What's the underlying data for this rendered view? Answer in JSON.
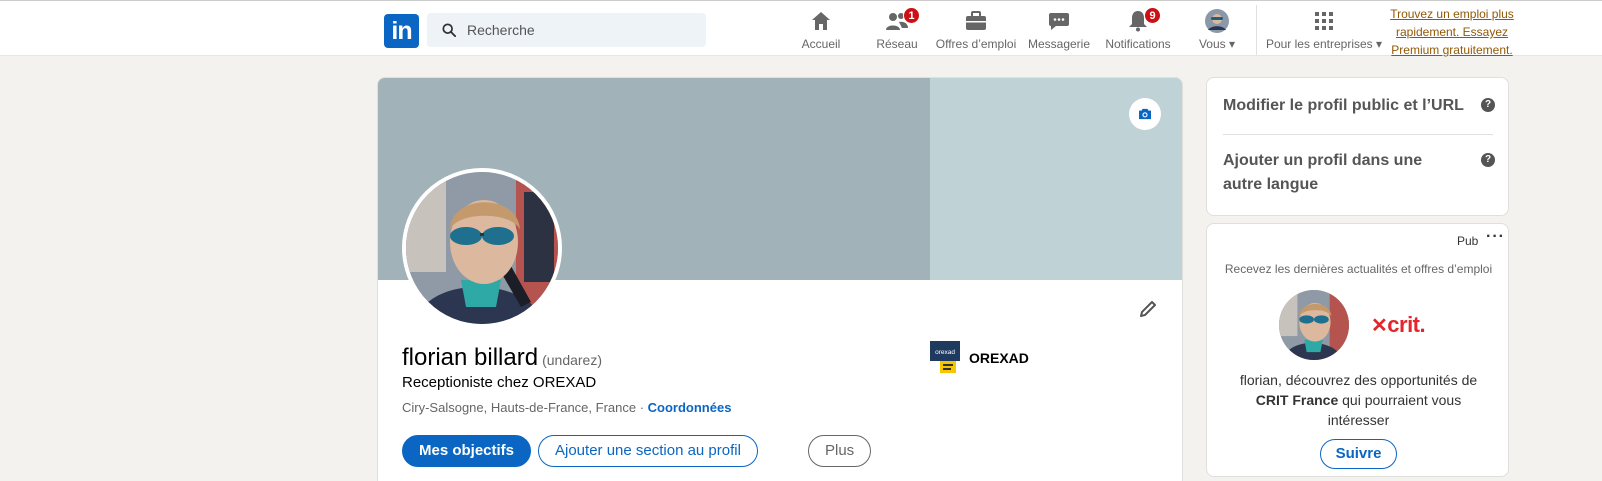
{
  "nav": {
    "logo_text": "in",
    "search_placeholder": "Recherche",
    "items": [
      {
        "label": "Accueil",
        "icon": "home-icon"
      },
      {
        "label": "Réseau",
        "icon": "network-icon",
        "badge": "1"
      },
      {
        "label": "Offres d’emploi",
        "icon": "briefcase-icon"
      },
      {
        "label": "Messagerie",
        "icon": "messaging-icon"
      },
      {
        "label": "Notifications",
        "icon": "bell-icon",
        "badge": "9"
      },
      {
        "label": "Vous",
        "icon": "avatar-icon"
      },
      {
        "label": "Pour les entreprises",
        "icon": "grid-icon"
      }
    ],
    "premium_text": "Trouvez un emploi plus rapidement. Essayez Premium gratuitement."
  },
  "profile": {
    "name": "florian billard",
    "pronunciation": "(undarez)",
    "headline": "Receptioniste chez OREXAD",
    "location": "Ciry-Salsogne, Hauts-de-France, France ·",
    "contact_link": "Coordonnées",
    "company": "OREXAD",
    "company_logo_text": "orexad",
    "buttons": {
      "primary": "Mes objectifs",
      "add_section": "Ajouter une section au profil",
      "more": "Plus"
    }
  },
  "sidebar": {
    "edit_public_profile": "Modifier le profil public et l’URL",
    "add_language_profile": "Ajouter un profil dans une autre langue"
  },
  "ad": {
    "tag": "Pub",
    "more": "···",
    "intro": "Recevez les dernières actualités et offres d’emploi",
    "brand": "crit.",
    "text_before": "florian, découvrez des opportunités de",
    "company": "CRIT France",
    "text_after": "qui pourraient vous intéresser",
    "follow": "Suivre"
  },
  "colors": {
    "brand_blue": "#0a66c2",
    "badge_red": "#cc1016",
    "premium_gold": "#915907",
    "crit_red": "#e3262d"
  }
}
